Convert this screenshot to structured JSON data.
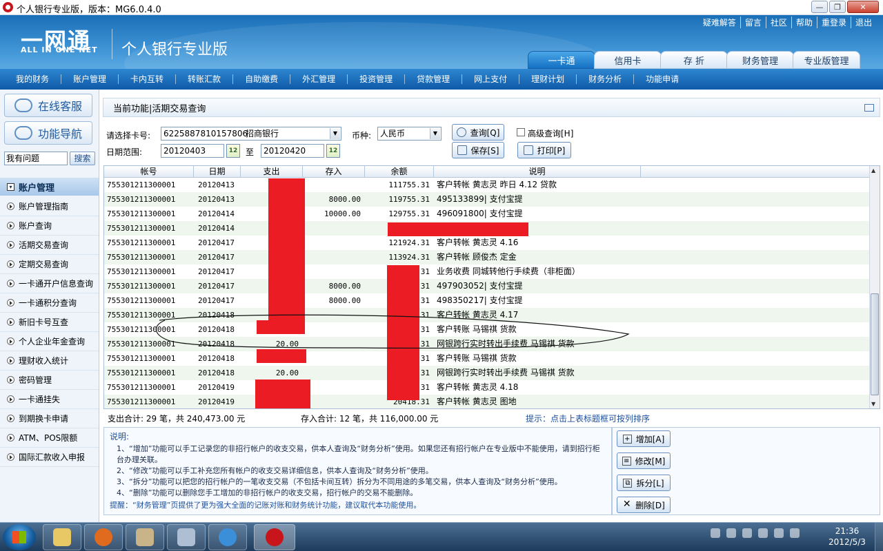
{
  "window": {
    "title": "个人银行专业版，版本：MG6.0.4.0"
  },
  "banner": {
    "brand_cn": "一网通",
    "brand_en": "ALL IN ONE NET",
    "product": "个人银行专业版",
    "toplinks": [
      "疑难解答",
      "留言",
      "社区",
      "帮助",
      "重登录",
      "退出"
    ],
    "tabs": [
      {
        "label": "一卡通",
        "active": true
      },
      {
        "label": "信用卡",
        "active": false
      },
      {
        "label": "存 折",
        "active": false
      },
      {
        "label": "财务管理",
        "active": false
      },
      {
        "label": "专业版管理",
        "active": false
      }
    ]
  },
  "nav": [
    "我的财务",
    "账户管理",
    "卡内互转",
    "转账汇款",
    "自助缴费",
    "外汇管理",
    "投资管理",
    "贷款管理",
    "网上支付",
    "理财计划",
    "财务分析",
    "功能申请"
  ],
  "sidebar": {
    "service_label": "在线客服",
    "guide_label": "功能导航",
    "search_value": "我有问题",
    "search_button": "搜索",
    "section_title": "账户管理",
    "items": [
      "账户管理指南",
      "账户查询",
      "活期交易查询",
      "定期交易查询",
      "一卡通开户信息查询",
      "一卡通积分查询",
      "新旧卡号互查",
      "个人企业年金查询",
      "理财收入统计",
      "密码管理",
      "一卡通挂失",
      "到期换卡申请",
      "ATM、POS限额",
      "国际汇款收入申报"
    ]
  },
  "crumb": "当前功能|活期交易查询",
  "query": {
    "card_label": "请选择卡号:",
    "card_number": "6225887810157806",
    "card_bank": "招商银行",
    "currency_label": "币种:",
    "currency_value": "人民币",
    "query_button": "查询[Q]",
    "advanced_label": "高级查询[H]",
    "date_label": "日期范围:",
    "date_from": "20120403",
    "date_to_label": "至",
    "date_to": "20120420",
    "save_button": "保存[S]",
    "print_button": "打印[P]"
  },
  "table": {
    "headers": [
      "帐号",
      "日期",
      "支出",
      "存入",
      "余额",
      "说明"
    ],
    "rows": [
      [
        "755301211300001",
        "20120413",
        "",
        "",
        "111755.31",
        "客户转帐 黄志灵 昨日 4.12 贷款"
      ],
      [
        "755301211300001",
        "20120413",
        "",
        "8000.00",
        "119755.31",
        "495133899| 支付宝提"
      ],
      [
        "755301211300001",
        "20120414",
        "",
        "10000.00",
        "129755.31",
        "496091800| 支付宝提"
      ],
      [
        "755301211300001",
        "20120414",
        "",
        "",
        "",
        ""
      ],
      [
        "755301211300001",
        "20120417",
        "",
        "",
        "121924.31",
        "客户转帐 黄志灵 4.16"
      ],
      [
        "755301211300001",
        "20120417",
        "",
        "",
        "113924.31",
        "客户转帐 顾俊杰 定金"
      ],
      [
        "755301211300001",
        "20120417",
        "",
        "",
        "31",
        "业务收费 同城转他行手续费（非柜面）"
      ],
      [
        "755301211300001",
        "20120417",
        "",
        "8000.00",
        "31",
        "497903052| 支付宝提"
      ],
      [
        "755301211300001",
        "20120417",
        "",
        "8000.00",
        "31",
        "498350217| 支付宝提"
      ],
      [
        "755301211300001",
        "20120418",
        "",
        "",
        "31",
        "客户转帐 黄志灵 4.17"
      ],
      [
        "755301211300001",
        "20120418",
        "",
        "",
        "31",
        "客户转账 马锡祺 货款"
      ],
      [
        "755301211300001",
        "20120418",
        "20.00",
        "",
        "31",
        "网银跨行实时转出手续费 马锡祺 货款"
      ],
      [
        "755301211300001",
        "20120418",
        "",
        "",
        "31",
        "客户转账 马锡祺 货款"
      ],
      [
        "755301211300001",
        "20120418",
        "20.00",
        "",
        "31",
        "网银跨行实时转出手续费 马锡祺 货款"
      ],
      [
        "755301211300001",
        "20120419",
        "",
        "",
        "31",
        "客户转帐 黄志灵 4.18"
      ],
      [
        "755301211300001",
        "20120419",
        "",
        "",
        "20418.31",
        "客户转帐 黄志灵 图地"
      ]
    ]
  },
  "summary": {
    "expense": "支出合计:   29 笔，共      240,473.00 元",
    "income": "存入合计:   12 笔，共      116,000.00 元",
    "hint": "提示：点击上表标题框可按列排序"
  },
  "notes": {
    "heading": "说明:",
    "lines": [
      "1、“增加”功能可以手工记录您的非招行帐户的收支交易，供本人查询及“财务分析”使用。如果您还有招行帐户在专业版中不能使用，请到招行柜台办理关联。",
      "2、“修改”功能可以手工补充您所有帐户的收支交易详细信息，供本人查询及“财务分析”使用。",
      "3、“拆分”功能可以把您的招行帐户的一笔收支交易（不包括卡间互转）拆分为不同用途的多笔交易，供本人查询及“财务分析”使用。",
      "4、“删除”功能可以删除您手工增加的非招行帐户的收支交易，招行帐户的交易不能删除。"
    ],
    "tip": "提醒：“财务管理”页提供了更为强大全面的记账对账和财务统计功能，建议取代本功能使用。"
  },
  "actions": {
    "add": "增加[A]",
    "edit": "修改[M]",
    "split": "拆分[L]",
    "delete": "删除[D]"
  },
  "taskbar": {
    "time": "21:36",
    "date": "2012/5/3"
  }
}
